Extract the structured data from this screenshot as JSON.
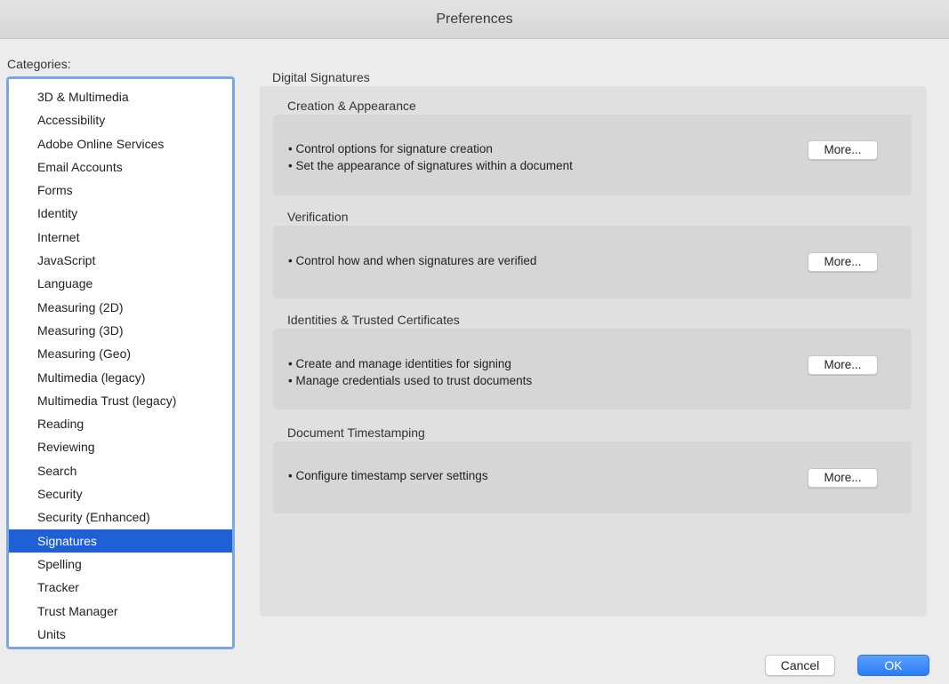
{
  "window": {
    "title": "Preferences"
  },
  "categories": {
    "label": "Categories:",
    "selected": "Signatures",
    "items": [
      "3D & Multimedia",
      "Accessibility",
      "Adobe Online Services",
      "Email Accounts",
      "Forms",
      "Identity",
      "Internet",
      "JavaScript",
      "Language",
      "Measuring (2D)",
      "Measuring (3D)",
      "Measuring (Geo)",
      "Multimedia (legacy)",
      "Multimedia Trust (legacy)",
      "Reading",
      "Reviewing",
      "Search",
      "Security",
      "Security (Enhanced)",
      "Signatures",
      "Spelling",
      "Tracker",
      "Trust Manager",
      "Units"
    ]
  },
  "panel": {
    "title": "Digital Signatures",
    "groups": [
      {
        "label": "Creation & Appearance",
        "bullets": [
          "• Control options for signature creation",
          "• Set the appearance of signatures within a document"
        ],
        "button": "More..."
      },
      {
        "label": "Verification",
        "bullets": [
          "• Control how and when signatures are verified"
        ],
        "button": "More..."
      },
      {
        "label": "Identities & Trusted Certificates",
        "bullets": [
          "• Create and manage identities for signing",
          "• Manage credentials used to trust documents"
        ],
        "button": "More..."
      },
      {
        "label": "Document Timestamping",
        "bullets": [
          "• Configure timestamp server settings"
        ],
        "button": "More..."
      }
    ]
  },
  "footer": {
    "cancel": "Cancel",
    "ok": "OK"
  },
  "colors": {
    "selection": "#1f60d6",
    "focus_ring": "#7aa6e8",
    "ok_button": "#2a7cf5"
  }
}
